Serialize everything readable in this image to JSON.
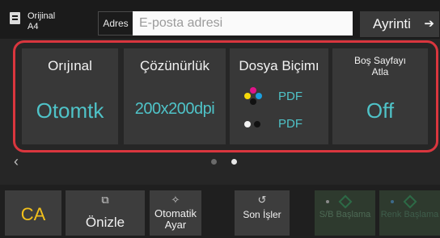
{
  "header": {
    "original_line1": "Orijinal",
    "original_line2": "A4",
    "address_label": "Adres",
    "address_placeholder": "E-posta adresi",
    "detail_label": "Ayrinti",
    "detail_arrow": "➔"
  },
  "tiles": [
    {
      "title": "Orıjınal",
      "value": "Otomtk"
    },
    {
      "title": "Çözünürlük",
      "value": "200x200dpi"
    },
    {
      "title": "Dosya Biçimı",
      "formats": [
        "PDF",
        "PDF"
      ]
    },
    {
      "title": "Boş Sayfayı Atla",
      "value": "Off"
    }
  ],
  "pagination": {
    "prev_arrow": "‹",
    "pages": 2,
    "current": 2
  },
  "bottom": {
    "ca": "CA",
    "preview": "Önizle",
    "auto_adjust": "Otomatik Ayar",
    "last_jobs": "Son İşler",
    "bw_start": "S/B Başlama",
    "color_start": "Renk Başlama"
  },
  "colors": {
    "accent_value": "#4fc3c8",
    "highlight": "#d9363e",
    "ca_yellow": "#f2c01b"
  }
}
